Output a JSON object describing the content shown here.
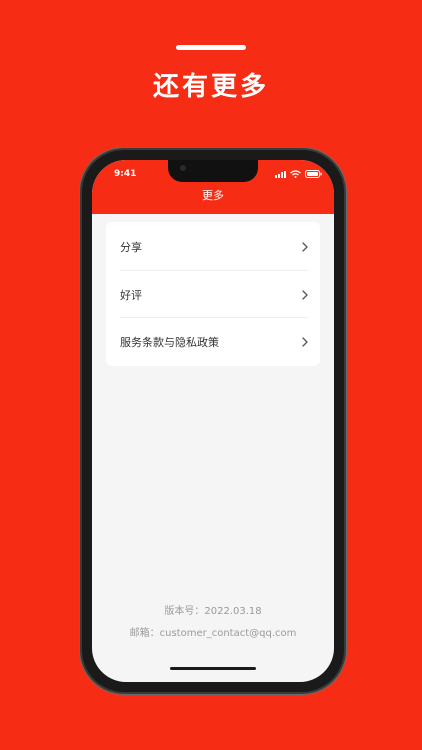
{
  "promo": {
    "title": "还有更多"
  },
  "status_bar": {
    "time": "9:41"
  },
  "nav": {
    "title": "更多"
  },
  "menu": {
    "items": [
      {
        "label": "分享",
        "icon": "chevron-right-icon"
      },
      {
        "label": "好评",
        "icon": "chevron-right-icon"
      },
      {
        "label": "服务条款与隐私政策",
        "icon": "chevron-right-icon"
      }
    ]
  },
  "footer": {
    "version": "版本号：2022.03.18",
    "email": "邮箱：customer_contact@qq.com"
  },
  "colors": {
    "brand": "#f62d14",
    "background": "#f5f5f5",
    "card": "#ffffff",
    "muted_text": "#9a9a9a"
  }
}
